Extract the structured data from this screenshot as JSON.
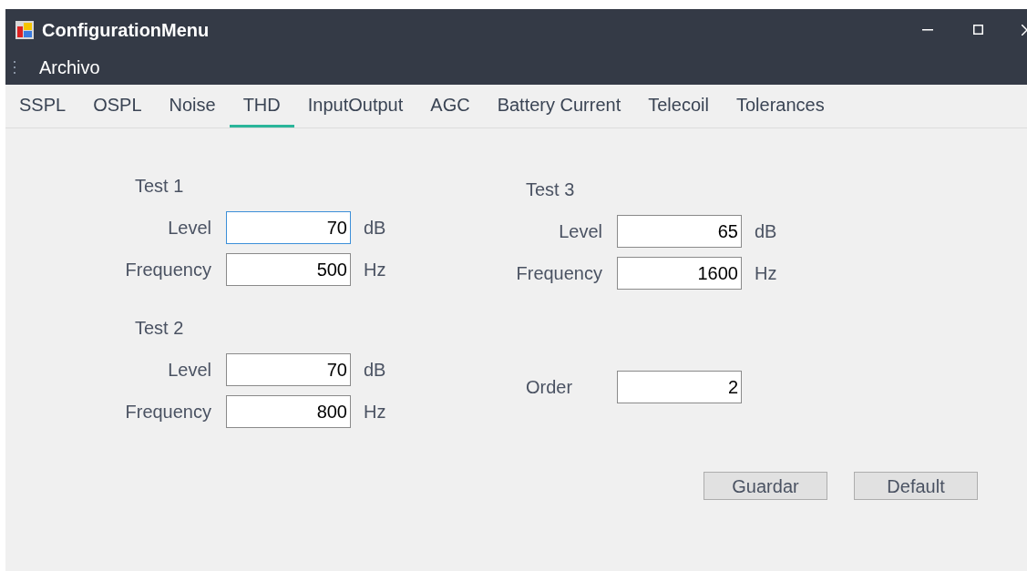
{
  "window": {
    "title": "ConfigurationMenu"
  },
  "menu": [
    "Archivo"
  ],
  "tabs": [
    {
      "label": "SSPL",
      "selected": false
    },
    {
      "label": "OSPL",
      "selected": false
    },
    {
      "label": "Noise",
      "selected": false
    },
    {
      "label": "THD",
      "selected": true
    },
    {
      "label": "InputOutput",
      "selected": false
    },
    {
      "label": "AGC",
      "selected": false
    },
    {
      "label": "Battery Current",
      "selected": false
    },
    {
      "label": "Telecoil",
      "selected": false
    },
    {
      "label": "Tolerances",
      "selected": false
    }
  ],
  "left_groups": [
    {
      "title": "Test 1",
      "rows": [
        {
          "label": "Level",
          "value": "70",
          "unit": "dB",
          "focused": true
        },
        {
          "label": "Frequency",
          "value": "500",
          "unit": "Hz",
          "focused": false
        }
      ]
    },
    {
      "title": "Test 2",
      "rows": [
        {
          "label": "Level",
          "value": "70",
          "unit": "dB",
          "focused": false
        },
        {
          "label": "Frequency",
          "value": "800",
          "unit": "Hz",
          "focused": false
        }
      ]
    }
  ],
  "right_group": {
    "title": "Test 3",
    "rows": [
      {
        "label": "Level",
        "value": "65",
        "unit": "dB",
        "focused": false
      },
      {
        "label": "Frequency",
        "value": "1600",
        "unit": "Hz",
        "focused": false
      }
    ]
  },
  "order": {
    "label": "Order",
    "value": "2",
    "focused": false
  },
  "buttons": [
    "Guardar",
    "Default"
  ]
}
